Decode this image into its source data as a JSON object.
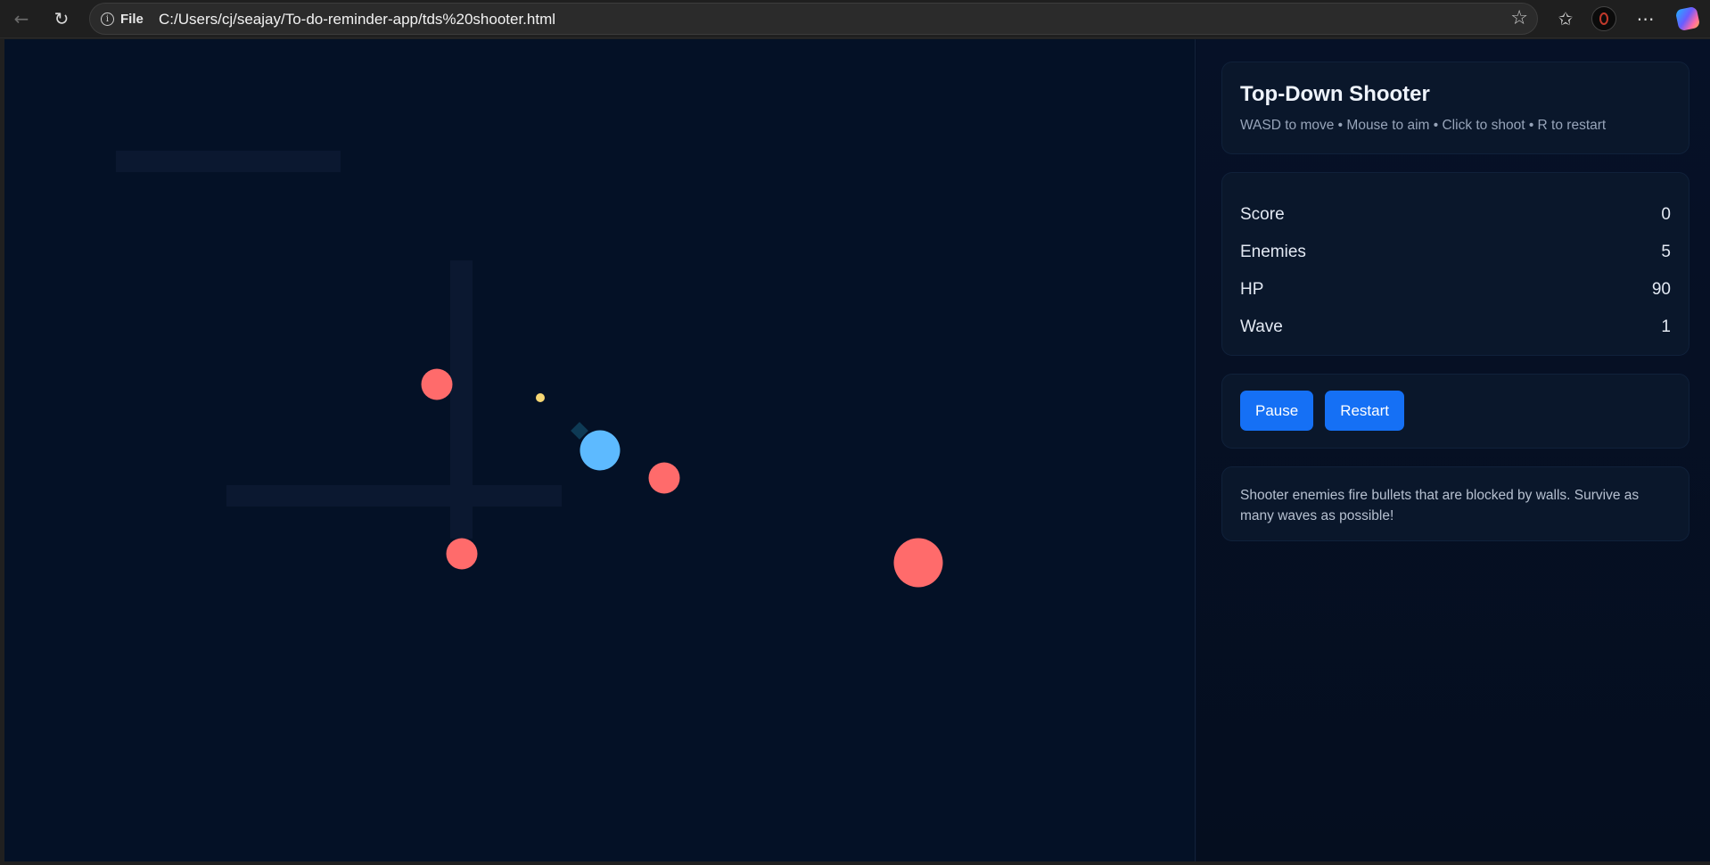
{
  "browser": {
    "file_label": "File",
    "url": "C:/Users/cj/seajay/To-do-reminder-app/tds%20shooter.html",
    "icons": {
      "back": "back-arrow-icon",
      "reload": "reload-icon",
      "info": "info-icon",
      "favorite": "star-icon",
      "favorites": "favorites-icon",
      "profile": "profile-icon",
      "more": "more-icon",
      "copilot": "copilot-icon"
    }
  },
  "game": {
    "colors": {
      "background": "#041126",
      "wall": "#0b1830",
      "enemy": "#ff6b6b",
      "player": "#5dbaff",
      "gun": "#0e3a55",
      "bullet": "#f7d774"
    }
  },
  "sidebar": {
    "title": "Top-Down Shooter",
    "subtitle": "WASD to move • Mouse to aim • Click to shoot • R to restart",
    "stats": [
      {
        "label": "Score",
        "value": "0"
      },
      {
        "label": "Enemies",
        "value": "5"
      },
      {
        "label": "HP",
        "value": "90"
      },
      {
        "label": "Wave",
        "value": "1"
      }
    ],
    "buttons": {
      "pause": "Pause",
      "restart": "Restart"
    },
    "info": "Shooter enemies fire bullets that are blocked by walls. Survive as many waves as possible!",
    "colors": {
      "accent": "#1570f5",
      "card": "#0a172b"
    }
  }
}
